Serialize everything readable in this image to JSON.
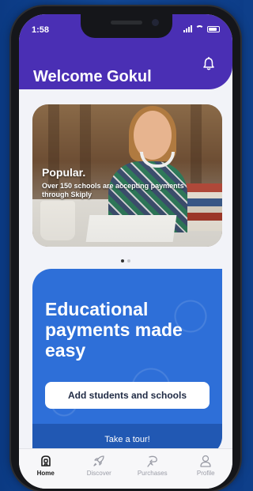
{
  "status_bar": {
    "time": "1:58"
  },
  "header": {
    "welcome": "Welcome Gokul"
  },
  "banner": {
    "title": "Popular.",
    "subtitle": "Over 150 schools are accepting payments through Skiply"
  },
  "carousel": {
    "pages": 2,
    "active_index": 0
  },
  "promo": {
    "title": "Educational payments made easy",
    "add_button": "Add students and schools",
    "tour_button": "Take a tour!"
  },
  "tabs": [
    {
      "label": "Home",
      "icon": "home-icon",
      "active": true
    },
    {
      "label": "Discover",
      "icon": "rocket-icon",
      "active": false
    },
    {
      "label": "Purchases",
      "icon": "purchase-icon",
      "active": false
    },
    {
      "label": "Profile",
      "icon": "profile-icon",
      "active": false
    }
  ],
  "colors": {
    "header": "#4a2fb4",
    "promo": "#2e6fd8",
    "tour": "#2158b3"
  }
}
